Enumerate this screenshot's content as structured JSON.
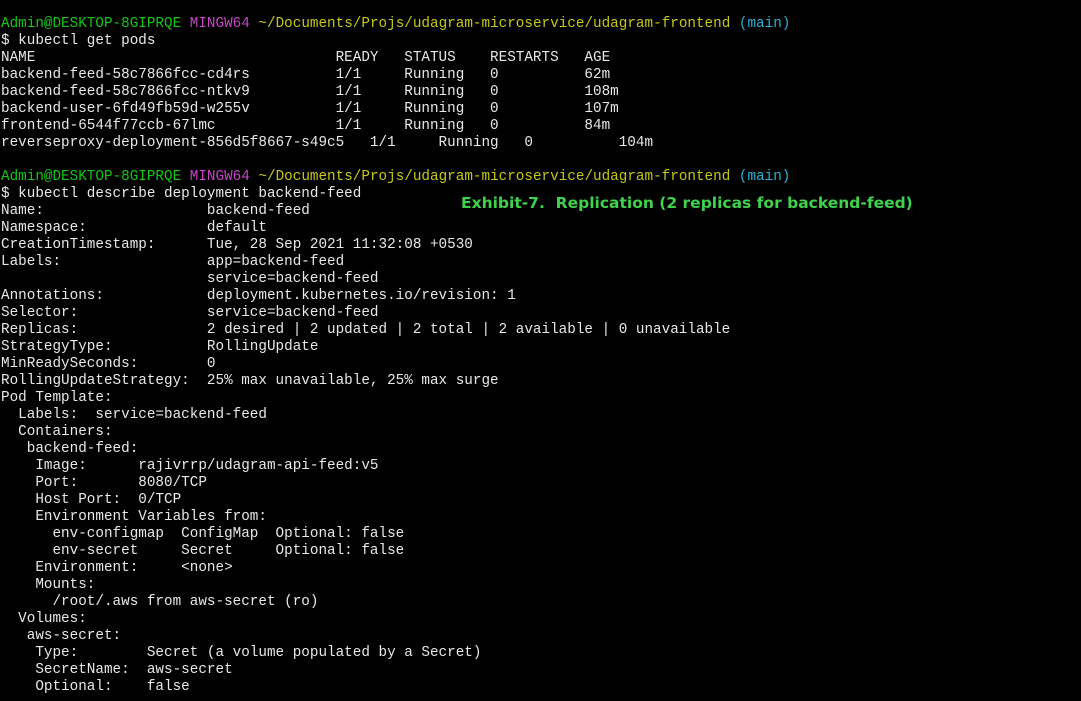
{
  "terminal": {
    "prompt1": {
      "user_host": "Admin@DESKTOP-8GIPRQE",
      "shell": "MINGW64",
      "path": "~/Documents/Projs/udagram-microservice/udagram-frontend",
      "branch": "(main)"
    },
    "command1": "$ kubectl get pods",
    "pods_table": {
      "header": "NAME                                   READY   STATUS    RESTARTS   AGE",
      "rows": [
        "backend-feed-58c7866fcc-cd4rs          1/1     Running   0          62m",
        "backend-feed-58c7866fcc-ntkv9          1/1     Running   0          108m",
        "backend-user-6fd49fb59d-w255v          1/1     Running   0          107m",
        "frontend-6544f77ccb-67lmc              1/1     Running   0          84m",
        "reverseproxy-deployment-856d5f8667-s49c5   1/1     Running   0          104m"
      ]
    },
    "prompt2": {
      "user_host": "Admin@DESKTOP-8GIPRQE",
      "shell": "MINGW64",
      "path": "~/Documents/Projs/udagram-microservice/udagram-frontend",
      "branch": "(main)"
    },
    "command2": "$ kubectl describe deployment backend-feed",
    "describe_lines": [
      "Name:                   backend-feed",
      "Namespace:              default",
      "CreationTimestamp:      Tue, 28 Sep 2021 11:32:08 +0530",
      "Labels:                 app=backend-feed",
      "                        service=backend-feed",
      "Annotations:            deployment.kubernetes.io/revision: 1",
      "Selector:               service=backend-feed",
      "Replicas:               2 desired | 2 updated | 2 total | 2 available | 0 unavailable",
      "StrategyType:           RollingUpdate",
      "MinReadySeconds:        0",
      "RollingUpdateStrategy:  25% max unavailable, 25% max surge",
      "Pod Template:",
      "  Labels:  service=backend-feed",
      "  Containers:",
      "   backend-feed:",
      "    Image:      rajivrrp/udagram-api-feed:v5",
      "    Port:       8080/TCP",
      "    Host Port:  0/TCP",
      "    Environment Variables from:",
      "      env-configmap  ConfigMap  Optional: false",
      "      env-secret     Secret     Optional: false",
      "    Environment:     <none>",
      "    Mounts:",
      "      /root/.aws from aws-secret (ro)",
      "  Volumes:",
      "   aws-secret:",
      "    Type:        Secret (a volume populated by a Secret)",
      "    SecretName:  aws-secret",
      "    Optional:    false"
    ],
    "caption": "Exhibit-7.  Replication (2 replicas for backend-feed)"
  },
  "colors": {
    "background": "#000000",
    "foreground": "#e8e8e8",
    "user_host": "#14c714",
    "shell": "#c746c7",
    "path": "#c8c814",
    "branch": "#27b2d6",
    "caption": "#3fd24b"
  }
}
